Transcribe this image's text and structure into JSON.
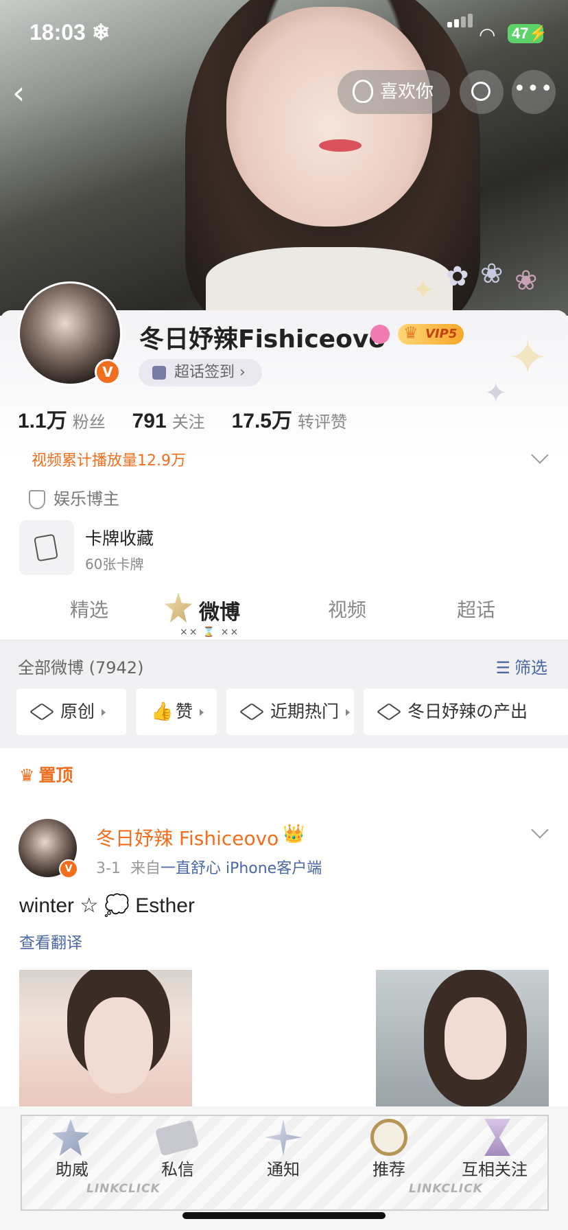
{
  "status_bar": {
    "time": "18:03",
    "snow": "❄",
    "battery": "47"
  },
  "header": {
    "like_label": "喜欢你"
  },
  "profile": {
    "name": "冬日妤辣Fishiceovo",
    "vip_label": "VIP5",
    "verified_letter": "V",
    "checkin_label": "超话签到 ›",
    "stats": [
      {
        "value": "1.1万",
        "label": "粉丝"
      },
      {
        "value": "791",
        "label": "关注"
      },
      {
        "value": "17.5万",
        "label": "转评赞"
      }
    ],
    "play_count": "视频累计播放量12.9万",
    "category": "娱乐博主",
    "cards": {
      "title": "卡牌收藏",
      "subtitle": "60张卡牌"
    }
  },
  "tabs": [
    {
      "label": "精选",
      "active": false
    },
    {
      "label": "微博",
      "active": true
    },
    {
      "label": "视频",
      "active": false
    },
    {
      "label": "超话",
      "active": false
    }
  ],
  "tab_decoration": "×× ⌛ ××",
  "feed": {
    "all_posts": "全部微博 (7942)",
    "filter_label": "筛选",
    "chips": [
      "原创",
      "赞",
      "近期热门",
      "冬日妤辣の产出"
    ],
    "pinned_label": "置顶"
  },
  "post": {
    "author": "冬日妤辣 Fishiceovo",
    "date": "3-1",
    "from_prefix": "来自",
    "source": "一直舒心 iPhone客户端",
    "text": "winter ☆ 💭 Esther",
    "translate_label": "查看翻译"
  },
  "bottom_nav": {
    "items": [
      "助威",
      "私信",
      "通知",
      "推荐",
      "互相关注"
    ],
    "deco_brand": "LINKCLICK"
  },
  "colors": {
    "accent_orange": "#f26d1c",
    "link_blue": "#4a67a8",
    "battery_green": "#5bd36a"
  }
}
